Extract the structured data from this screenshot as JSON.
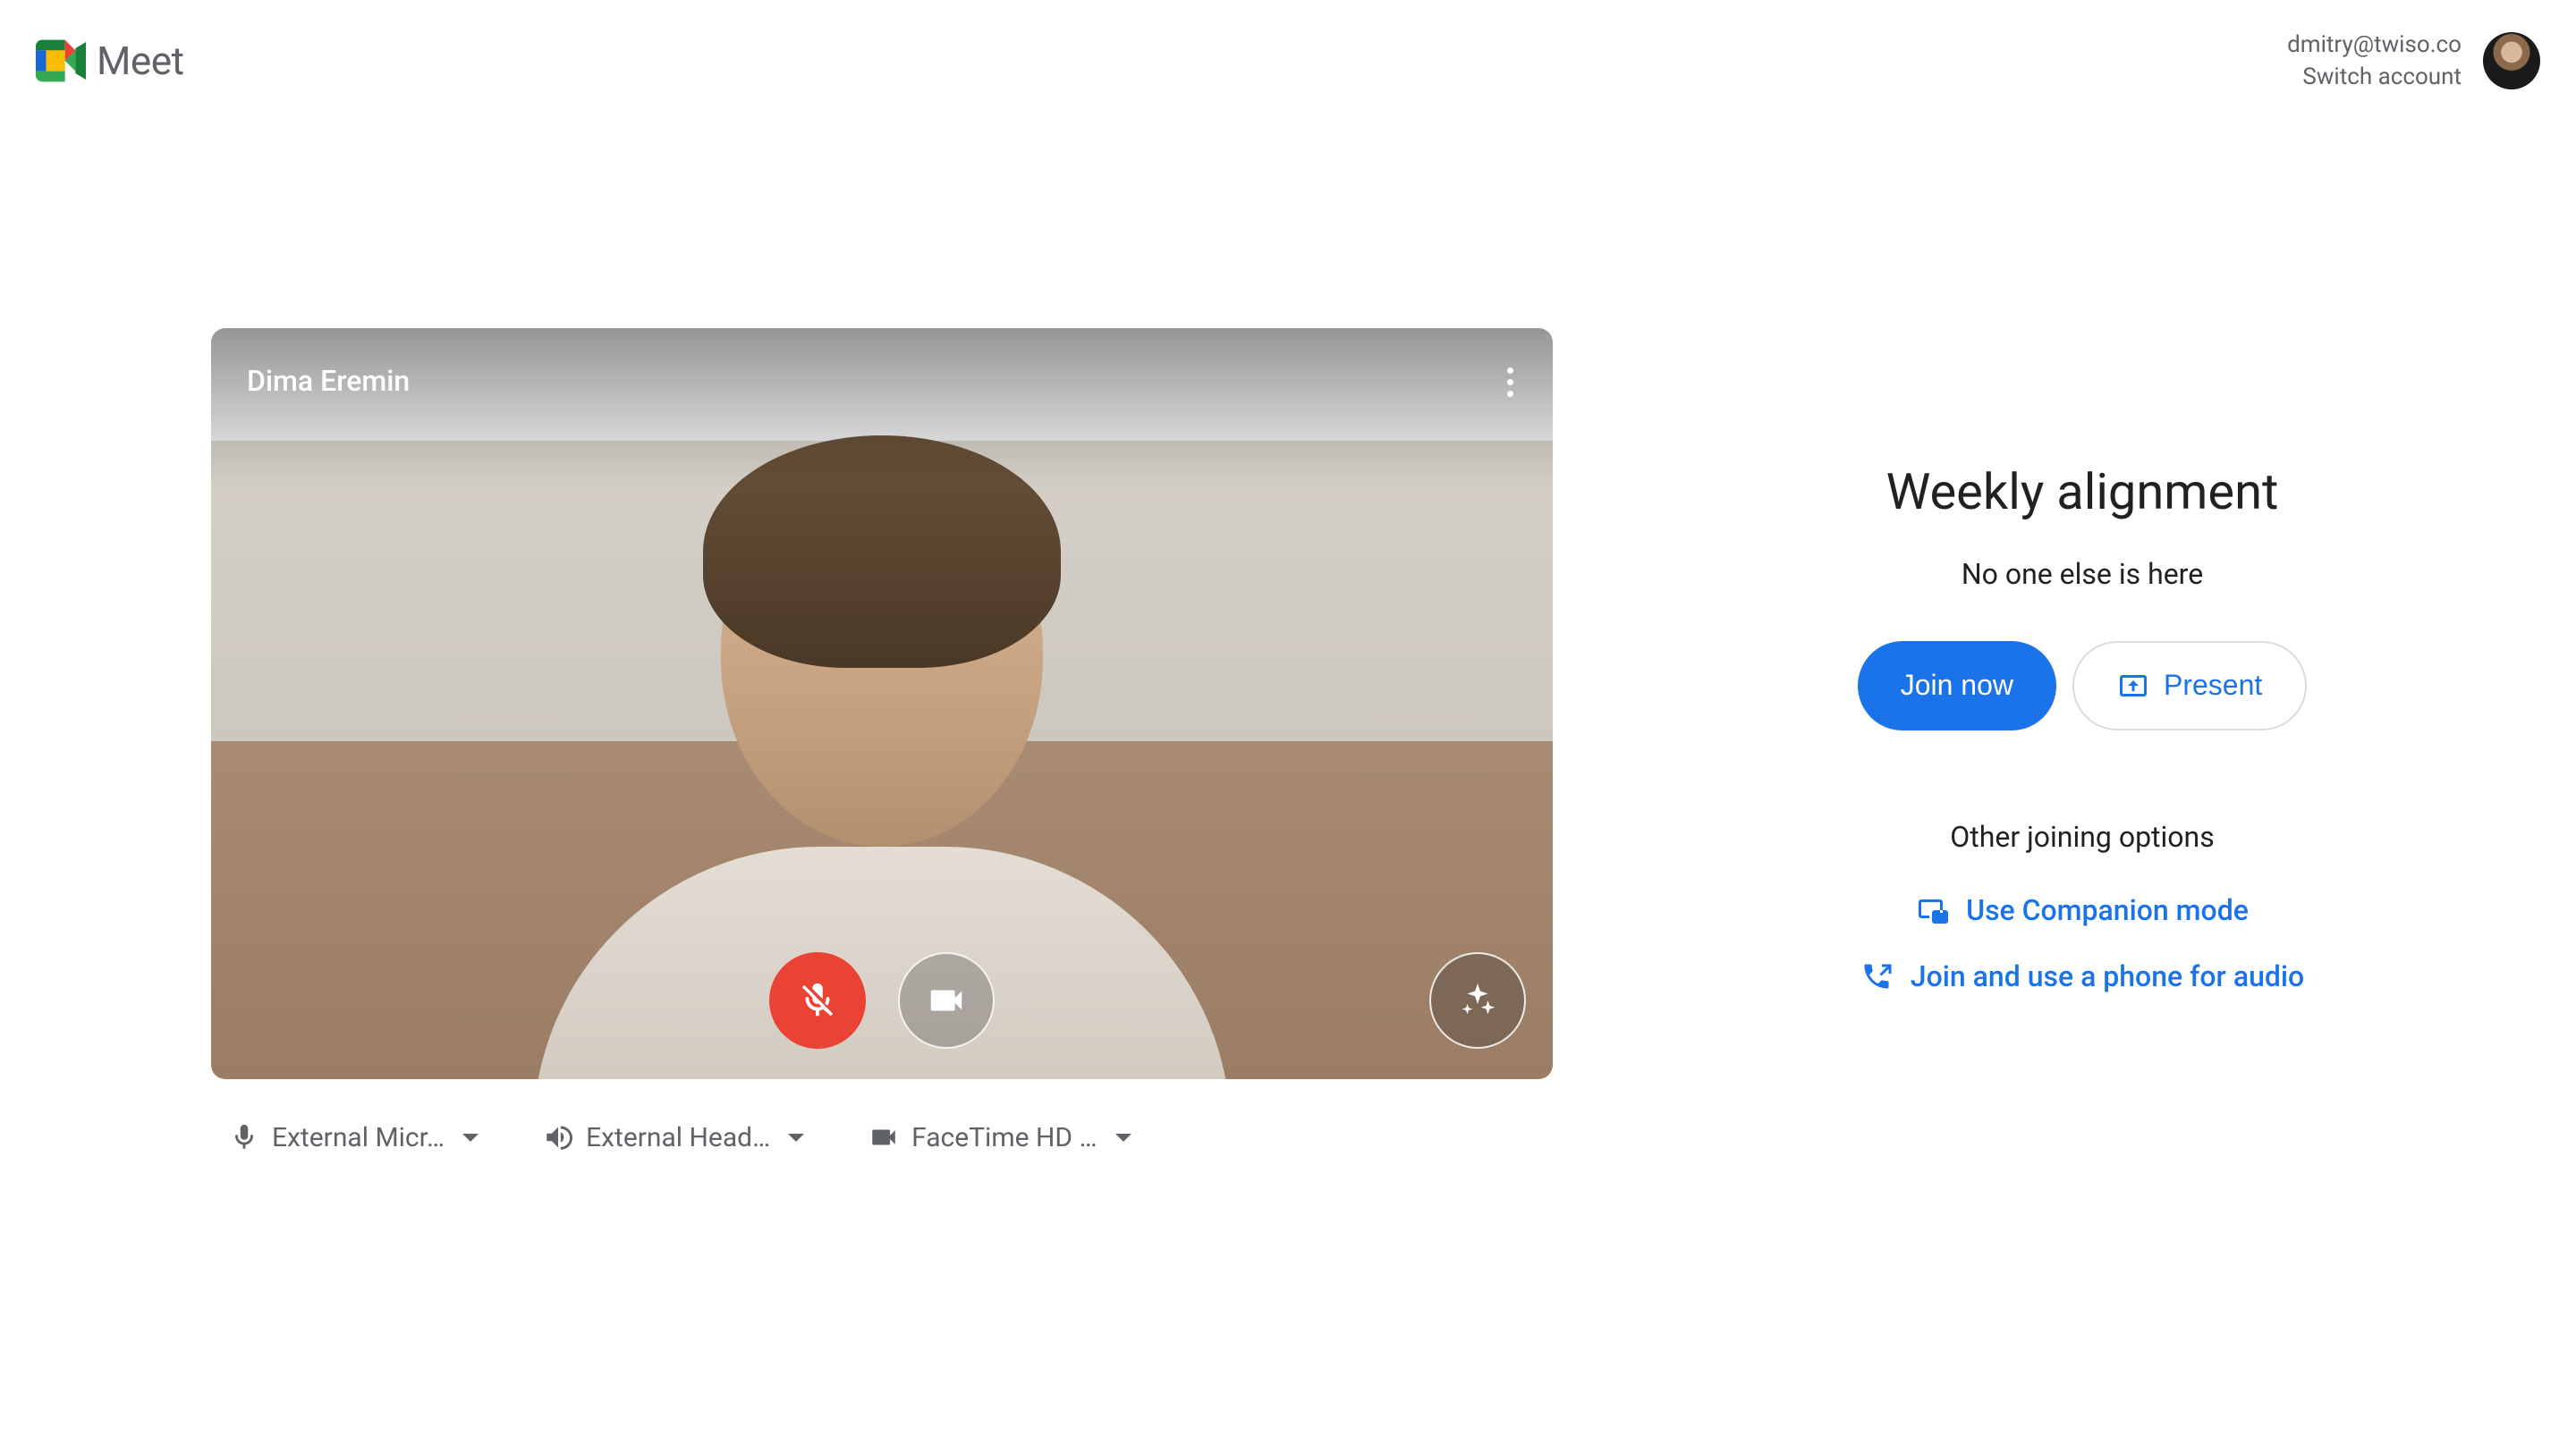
{
  "header": {
    "product": "Meet",
    "email": "dmitry@twiso.co",
    "switch": "Switch account"
  },
  "video": {
    "participant_name": "Dima Eremin"
  },
  "devices": {
    "mic": "External Micr…",
    "speaker": "External Head…",
    "camera": "FaceTime HD …"
  },
  "meeting": {
    "title": "Weekly alignment",
    "presence": "No one else is here",
    "join_label": "Join now",
    "present_label": "Present",
    "other_heading": "Other joining options",
    "companion": "Use Companion mode",
    "phone": "Join and use a phone for audio"
  }
}
